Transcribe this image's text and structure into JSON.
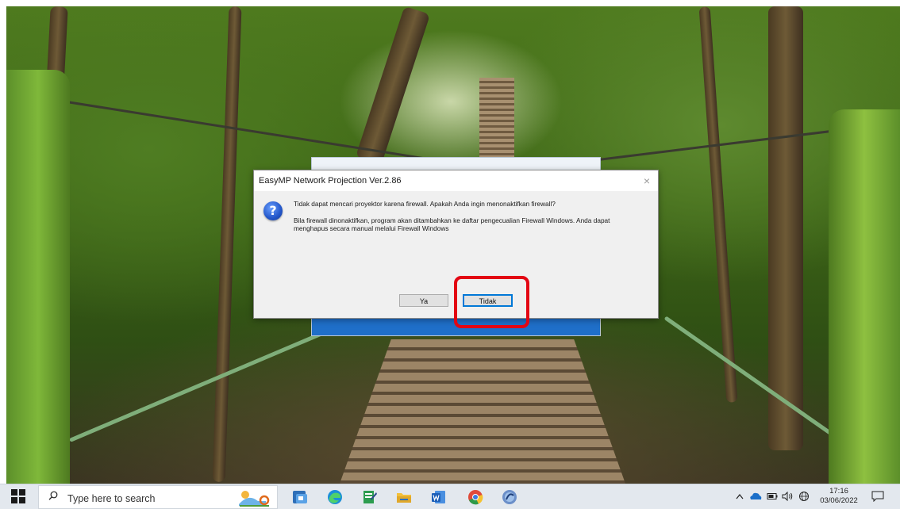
{
  "dialog": {
    "title": "EasyMP Network Projection Ver.2.86",
    "close_glyph": "×",
    "icon": "question-icon",
    "message_main": "Tidak dapat mencari proyektor karena firewall. Apakah Anda ingin menonaktifkan firewall?",
    "message_detail": "Bila firewall dinonaktifkan, program akan ditambahkan ke daftar pengecualian Firewall Windows. Anda dapat menghapus secara manual melalui Firewall Windows",
    "buttons": {
      "yes": "Ya",
      "no": "Tidak"
    }
  },
  "highlight": {
    "color": "#e30613",
    "target": "no-button"
  },
  "taskbar": {
    "search_placeholder": "Type here to search",
    "apps": [
      "file-explorer-icon",
      "edge-icon",
      "notepad-icon",
      "folder-icon",
      "word-icon",
      "chrome-icon",
      "easymp-icon"
    ],
    "tray": {
      "time": "17:16",
      "date": "03/06/2022"
    }
  },
  "colors": {
    "taskbar_bg": "#e3e8ee",
    "dialog_bg": "#f0f0f0",
    "accent_blue": "#1f6fc9"
  }
}
